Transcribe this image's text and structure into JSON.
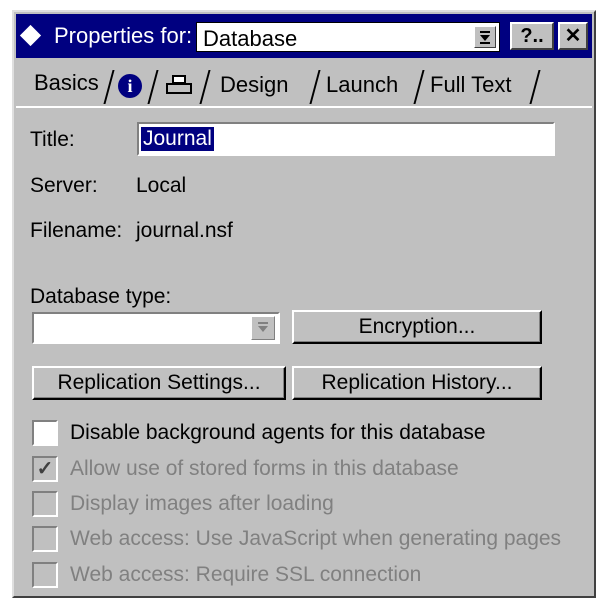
{
  "titlebar": {
    "label": "Properties for:",
    "selected_object": "Database",
    "help_label": "?..",
    "close_label": "✕"
  },
  "tabs": [
    {
      "label": "Basics",
      "type": "text",
      "active": true
    },
    {
      "label": "",
      "type": "icon",
      "icon": "info-icon"
    },
    {
      "label": "",
      "type": "icon",
      "icon": "printer-icon"
    },
    {
      "label": "Design",
      "type": "text"
    },
    {
      "label": "Launch",
      "type": "text"
    },
    {
      "label": "Full Text",
      "type": "text"
    }
  ],
  "fields": {
    "title_label": "Title:",
    "title_value": "Journal",
    "server_label": "Server:",
    "server_value": "Local",
    "filename_label": "Filename:",
    "filename_value": "journal.nsf",
    "db_type_label": "Database type:",
    "db_type_value": ""
  },
  "buttons": {
    "encryption": "Encryption...",
    "replication_settings": "Replication Settings...",
    "replication_history": "Replication History..."
  },
  "checkboxes": [
    {
      "label": "Disable background agents for this database",
      "checked": false,
      "enabled": true
    },
    {
      "label": "Allow use of stored forms in this database",
      "checked": true,
      "enabled": false
    },
    {
      "label": "Display images after loading",
      "checked": false,
      "enabled": false
    },
    {
      "label": "Web access:  Use JavaScript when generating pages",
      "checked": false,
      "enabled": false
    },
    {
      "label": "Web access:  Require SSL connection",
      "checked": false,
      "enabled": false
    }
  ],
  "colors": {
    "titlebar": "#000080",
    "dialog_face": "#c0c0c0",
    "disabled_text": "#808080"
  }
}
